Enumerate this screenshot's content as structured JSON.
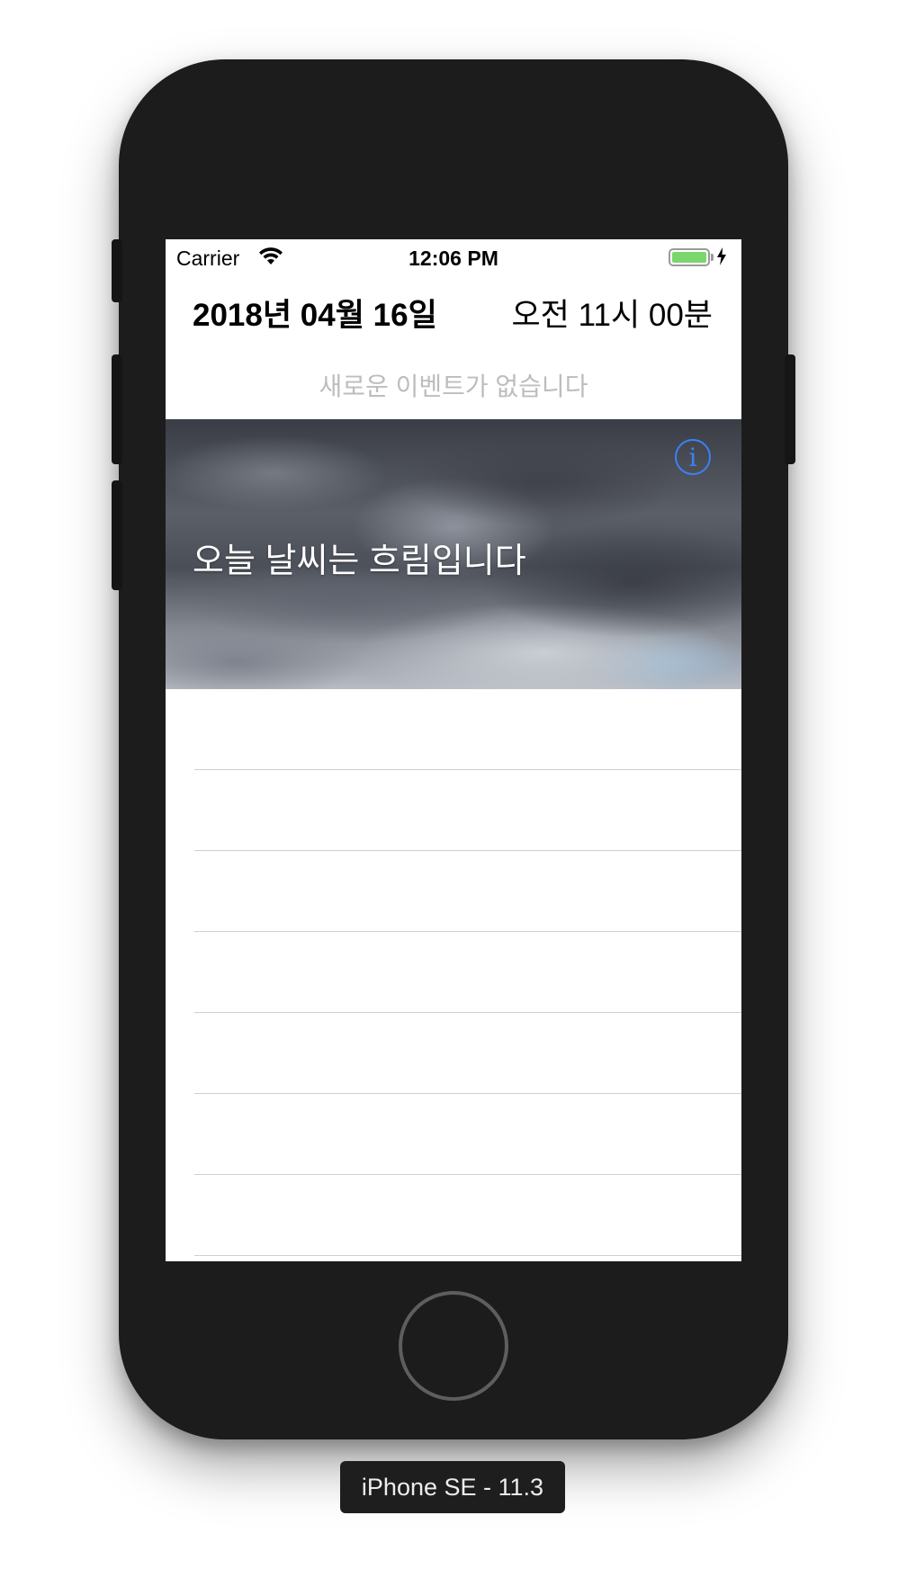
{
  "status_bar": {
    "carrier": "Carrier",
    "time": "12:06 PM",
    "wifi_icon": "wifi-icon",
    "battery_icon": "battery-charging-icon"
  },
  "header": {
    "date": "2018년 04월 16일",
    "time": "오전 11시 00분"
  },
  "events": {
    "empty_message": "새로운 이벤트가 없습니다"
  },
  "weather": {
    "message": "오늘 날씨는 흐림입니다",
    "info_icon": "info-icon",
    "info_glyph": "i",
    "accent_color": "#3a82f7"
  },
  "list": {
    "rows": [
      "",
      "",
      "",
      "",
      "",
      "",
      ""
    ]
  },
  "device": {
    "label": "iPhone SE - 11.3"
  }
}
